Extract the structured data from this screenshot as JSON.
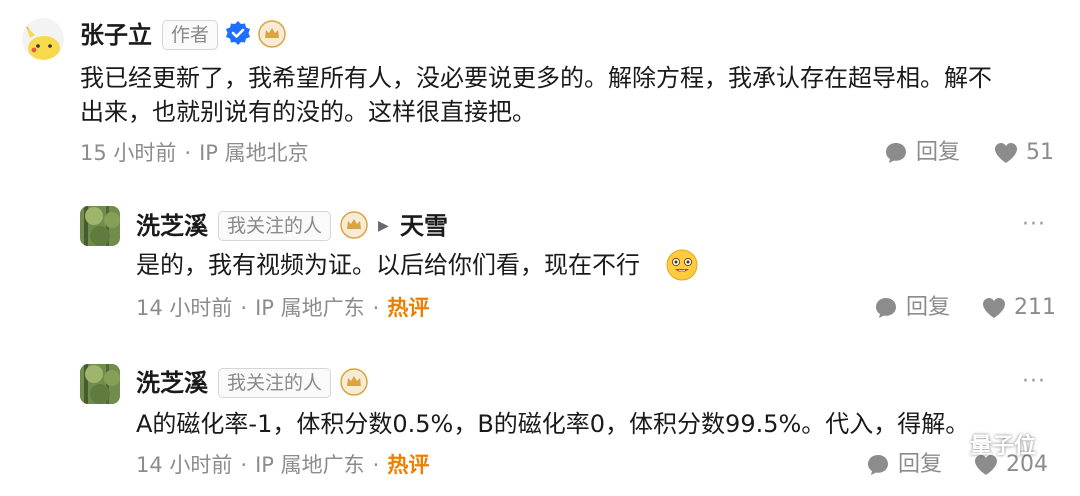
{
  "comments": [
    {
      "author": "张子立",
      "tag": "作者",
      "text_line1": "我已经更新了，我希望所有人，没必要说更多的。解除方程，我承认存在超导相。解不",
      "text_line2": "出来，也就别说有的没的。这样很直接把。",
      "time": "15 小时前",
      "location": "IP 属地北京",
      "reply_label": "回复",
      "likes": "51"
    },
    {
      "author": "洗芝溪",
      "tag": "我关注的人",
      "reply_to": "天雪",
      "text": "是的，我有视频为证。以后给你们看，现在不行",
      "time": "14 小时前",
      "location": "IP 属地广东",
      "hot": "热评",
      "reply_label": "回复",
      "likes": "211"
    },
    {
      "author": "洗芝溪",
      "tag": "我关注的人",
      "text": "A的磁化率-1，体积分数0.5%，B的磁化率0，体积分数99.5%。代入，得解。",
      "time": "14 小时前",
      "location": "IP 属地广东",
      "hot": "热评",
      "reply_label": "回复",
      "likes": "204"
    }
  ],
  "more_glyph": "···",
  "separator": "·",
  "watermark": "量子位",
  "colors": {
    "hot": "#ec7f00",
    "meta": "#8c8c8c",
    "verified": "#1e6fff",
    "badge": "#d9a441"
  }
}
